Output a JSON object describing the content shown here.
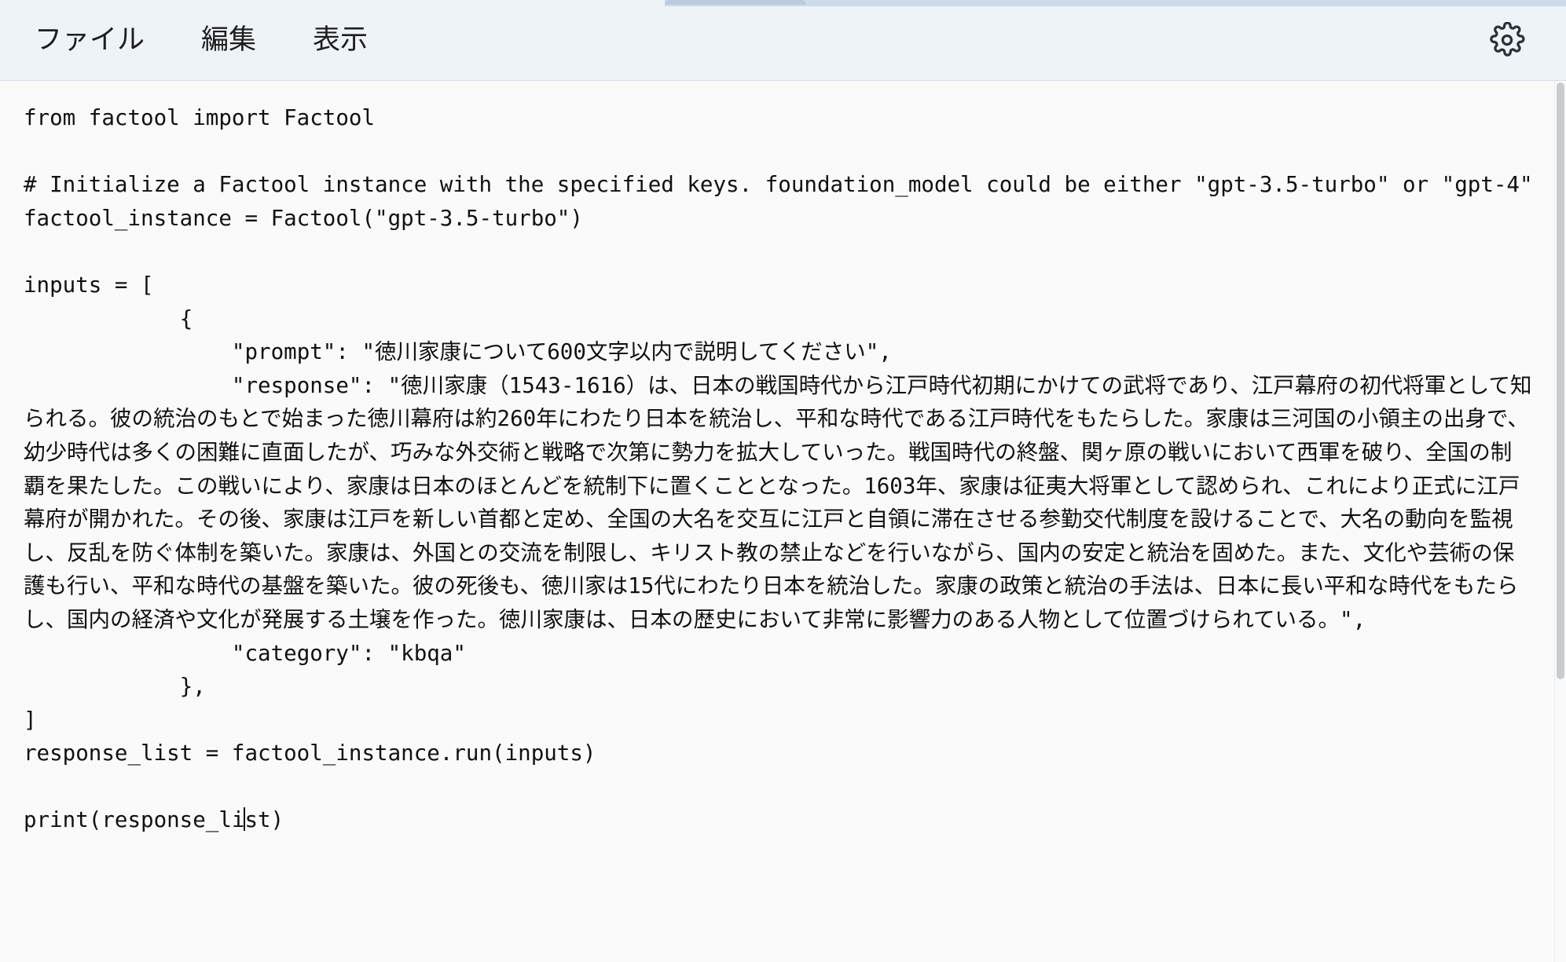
{
  "window": {
    "background_color": "#ffffff",
    "menubar_color": "#eef3f8",
    "editor_background": "#fafafa",
    "text_color": "#111111"
  },
  "chrome": {
    "tab_strip_color": "#cddbe8",
    "tab_color": "#b9cbdc"
  },
  "menubar": {
    "items": [
      {
        "id": "file",
        "label": "ファイル"
      },
      {
        "id": "edit",
        "label": "編集"
      },
      {
        "id": "view",
        "label": "表示"
      }
    ],
    "settings_icon": "gear-icon"
  },
  "editor": {
    "language": "python",
    "caret_visible": true,
    "caret_line": "print(response_list)",
    "caret_column": 16,
    "code_before_caret": "from factool import Factool\n\n# Initialize a Factool instance with the specified keys. foundation_model could be either \"gpt-3.5-turbo\" or \"gpt-4\"\nfactool_instance = Factool(\"gpt-3.5-turbo\")\n\ninputs = [\n            {\n                \"prompt\": \"徳川家康について600文字以内で説明してください\",\n                \"response\": \"徳川家康（1543-1616）は、日本の戦国時代から江戸時代初期にかけての武将であり、江戸幕府の初代将軍として知られる。彼の統治のもとで始まった徳川幕府は約260年にわたり日本を統治し、平和な時代である江戸時代をもたらした。家康は三河国の小領主の出身で、幼少時代は多くの困難に直面したが、巧みな外交術と戦略で次第に勢力を拡大していった。戦国時代の終盤、関ヶ原の戦いにおいて西軍を破り、全国の制覇を果たした。この戦いにより、家康は日本のほとんどを統制下に置くこととなった。1603年、家康は征夷大将軍として認められ、これにより正式に江戸幕府が開かれた。その後、家康は江戸を新しい首都と定め、全国の大名を交互に江戸と自領に滞在させる参勤交代制度を設けることで、大名の動向を監視し、反乱を防ぐ体制を築いた。家康は、外国との交流を制限し、キリスト教の禁止などを行いながら、国内の安定と統治を固めた。また、文化や芸術の保護も行い、平和な時代の基盤を築いた。彼の死後も、徳川家は15代にわたり日本を統治した。家康の政策と統治の手法は、日本に長い平和な時代をもたらし、国内の経済や文化が発展する土壌を作った。徳川家康は、日本の歴史において非常に影響力のある人物として位置づけられている。\",\n                \"category\": \"kbqa\"\n            },\n]\nresponse_list = factool_instance.run(inputs)\n\nprint(response_li",
    "code_after_caret": "st)"
  },
  "scrollbar": {
    "orientation": "vertical",
    "thumb_color": "#c9cccf"
  }
}
